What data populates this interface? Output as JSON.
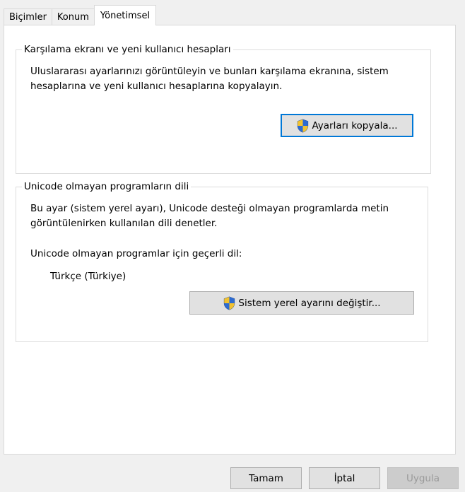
{
  "tabs": [
    {
      "label": "Biçimler"
    },
    {
      "label": "Konum"
    },
    {
      "label": "Yönetimsel"
    }
  ],
  "welcome_group": {
    "title": "Karşılama ekranı ve yeni kullanıcı hesapları",
    "line1": "Uluslararası ayarlarınızı görüntüleyin ve bunları karşılama ekranına, sistem",
    "line2": "hesaplarına ve yeni kullanıcı hesaplarına kopyalayın.",
    "copy_button": "Ayarları kopyala..."
  },
  "unicode_group": {
    "title": "Unicode olmayan programların dili",
    "line1": "Bu ayar (sistem yerel ayarı), Unicode desteği olmayan programlarda metin",
    "line2": "görüntülenirken kullanılan dili denetler.",
    "current_label": "Unicode olmayan programlar için geçerli dil:",
    "current_value": "Türkçe (Türkiye)",
    "change_button": "Sistem yerel ayarını değiştir..."
  },
  "footer": {
    "ok": "Tamam",
    "cancel": "İptal",
    "apply": "Uygula"
  },
  "icons": {
    "shield": "uac-shield-icon"
  }
}
